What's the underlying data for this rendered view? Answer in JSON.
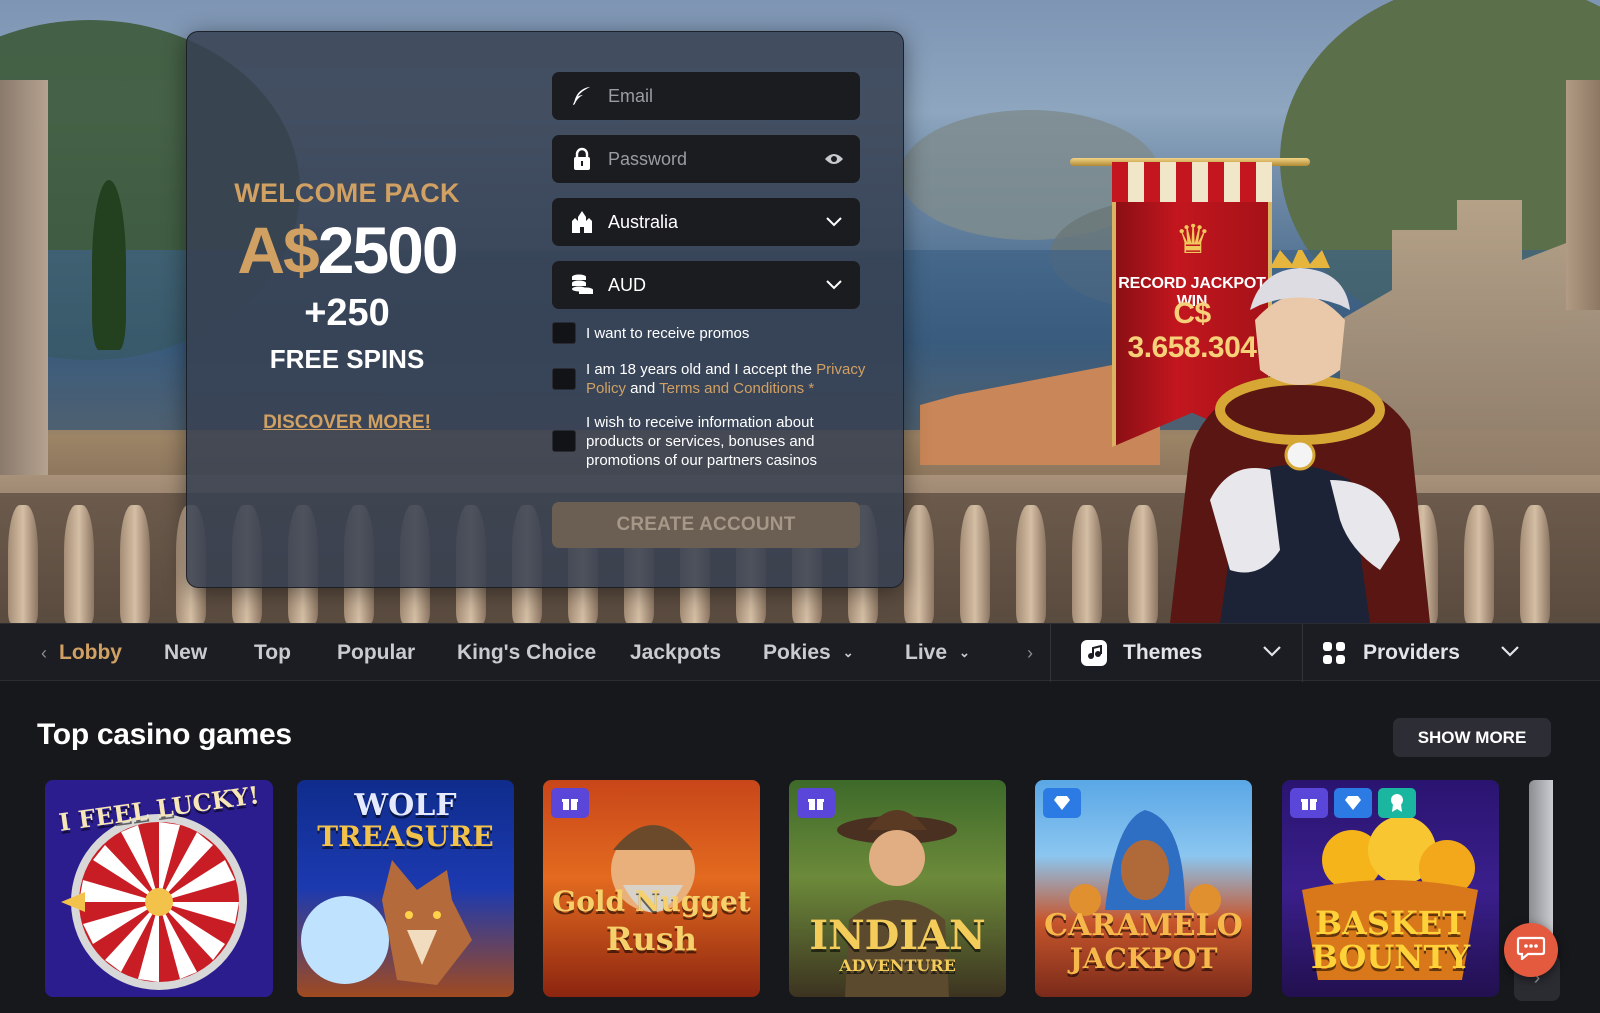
{
  "signup": {
    "welcome_label": "WELCOME PACK",
    "amount_currency": "A$",
    "amount_value": "2500",
    "spins_count": "+250",
    "spins_label": "FREE SPINS",
    "discover_link": "DISCOVER MORE!",
    "email_placeholder": "Email",
    "password_placeholder": "Password",
    "country_value": "Australia",
    "currency_value": "AUD",
    "checkbox_promos": "I want to receive promos",
    "checkbox_terms_prefix": "I am 18 years old and I accept the ",
    "checkbox_terms_privacy": "Privacy Policy",
    "checkbox_terms_and": " and ",
    "checkbox_terms_conditions": "Terms and Conditions",
    "checkbox_terms_required": " *",
    "checkbox_partners": "I wish to receive information about products or services, bonuses and promotions of our partners casinos",
    "create_button": "CREATE ACCOUNT"
  },
  "banner": {
    "title": "RECORD JACKPOT WIN",
    "amount": "C$ 3.658.304"
  },
  "nav": {
    "items": [
      "Lobby",
      "New",
      "Top",
      "Popular",
      "King's Choice",
      "Jackpots",
      "Pokies",
      "Live"
    ],
    "active": "Lobby",
    "themes_label": "Themes",
    "providers_label": "Providers"
  },
  "section": {
    "title": "Top casino games",
    "show_more": "SHOW MORE"
  },
  "games": [
    {
      "name_line1": "I FEEL LUCKY!",
      "name_line2": ""
    },
    {
      "name_line1": "WOLF",
      "name_line2": "TREASURE"
    },
    {
      "name_line1": "Gold Nugget",
      "name_line2": "Rush",
      "badges": [
        "gift"
      ]
    },
    {
      "name_line1": "INDIAN",
      "name_line2": "ADVENTURE",
      "badges": [
        "gift"
      ]
    },
    {
      "name_line1": "CARAMELO",
      "name_line2": "JACKPOT",
      "badges": [
        "gem"
      ]
    },
    {
      "name_line1": "BASKET",
      "name_line2": "BOUNTY",
      "badges": [
        "gift",
        "gem",
        "award"
      ]
    }
  ],
  "colors": {
    "accent_gold": "#d1a063",
    "background": "#17181c",
    "chat_button": "#e45a3f"
  },
  "icons": {
    "email": "feather-pen-icon",
    "password": "padlock-icon",
    "password_toggle": "eye-icon",
    "country": "castle-icon",
    "currency": "coins-icon",
    "themes": "themes-icon",
    "providers": "grid-icon",
    "chat": "chat-icon"
  }
}
